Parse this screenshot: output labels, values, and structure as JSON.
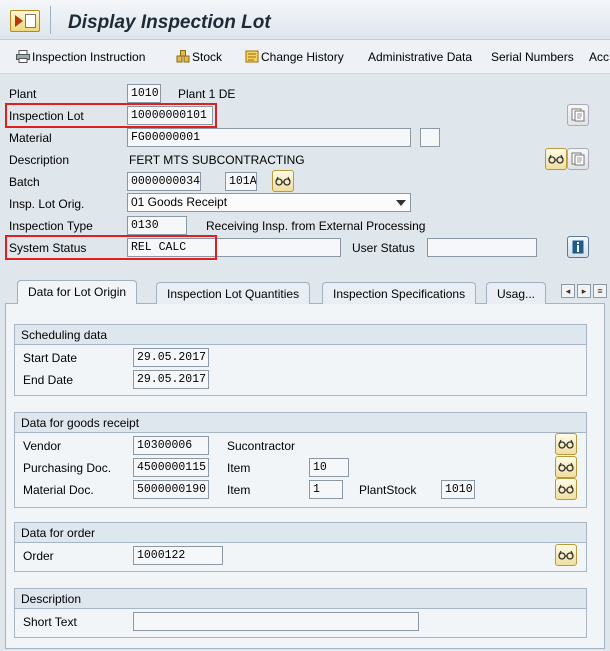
{
  "title": "Display Inspection Lot",
  "toolbar": {
    "inspection_instruction": "Inspection Instruction",
    "stock": "Stock",
    "change_history": "Change History",
    "administrative_data": "Administrative Data",
    "serial_numbers": "Serial Numbers",
    "overflow": "Acc"
  },
  "header": {
    "plant_label": "Plant",
    "plant_value": "1010",
    "plant_desc": "Plant 1 DE",
    "lot_label": "Inspection Lot",
    "lot_value": "10000000101",
    "material_label": "Material",
    "material_value": "FG00000001",
    "description_label": "Description",
    "description_value": "FERT MTS SUBCONTRACTING",
    "batch_label": "Batch",
    "batch_value": "0000000034",
    "batch_extra": "101A",
    "origin_label": "Insp. Lot Orig.",
    "origin_value": "01 Goods Receipt",
    "type_label": "Inspection Type",
    "type_value": "0130",
    "type_desc": "Receiving Insp. from External Processing",
    "system_status_label": "System Status",
    "system_status_value": "REL  CALC",
    "user_status_label": "User Status",
    "user_status_value": ""
  },
  "tabs": [
    {
      "label": "Data for Lot Origin"
    },
    {
      "label": "Inspection Lot Quantities"
    },
    {
      "label": "Inspection Specifications"
    },
    {
      "label": "Usag..."
    }
  ],
  "scheduling": {
    "title": "Scheduling data",
    "start_label": "Start Date",
    "start_value": "29.05.2017",
    "end_label": "End Date",
    "end_value": "29.05.2017"
  },
  "goods_receipt": {
    "title": "Data for goods receipt",
    "vendor_label": "Vendor",
    "vendor_value": "10300006",
    "vendor_desc": "Sucontractor",
    "po_label": "Purchasing Doc.",
    "po_value": "4500000115",
    "po_item_label": "Item",
    "po_item_value": "10",
    "matdoc_label": "Material Doc.",
    "matdoc_value": "5000000190",
    "matdoc_item_label": "Item",
    "matdoc_item_value": "1",
    "plantstock_label": "PlantStock",
    "plantstock_value": "1010"
  },
  "order": {
    "title": "Data for order",
    "order_label": "Order",
    "order_value": "1000122"
  },
  "description_group": {
    "title": "Description",
    "short_text_label": "Short Text",
    "short_text_value": ""
  },
  "colors": {
    "highlight": "#e02020",
    "background": "#dfe6ec"
  },
  "icons": [
    "title-icon",
    "printer-icon",
    "stock-icon",
    "change-history-icon",
    "display-icon",
    "glasses-icon",
    "info-icon"
  ]
}
